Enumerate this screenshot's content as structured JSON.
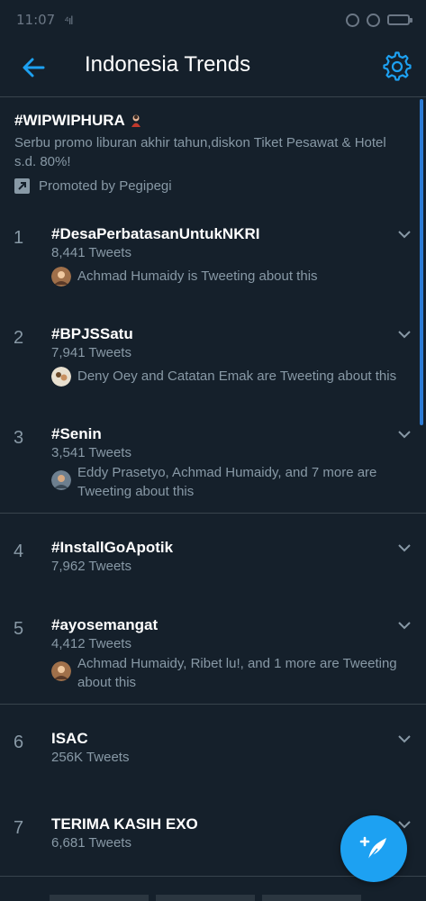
{
  "statusbar": {
    "time": "11:07",
    "signal": "⁴ıl"
  },
  "header": {
    "title": "Indonesia Trends"
  },
  "promo": {
    "title": "#WIPWIPHURA",
    "description": "Serbu promo liburan akhir tahun,diskon Tiket Pesawat & Hotel s.d. 80%!",
    "promoted_by": "Promoted by Pegipegi"
  },
  "trends": [
    {
      "rank": "1",
      "name": "#DesaPerbatasanUntukNKRI",
      "count": "8,441 Tweets",
      "context": "Achmad Humaidy is Tweeting about this"
    },
    {
      "rank": "2",
      "name": "#BPJSSatu",
      "count": "7,941 Tweets",
      "context": "Deny Oey and Catatan Emak are Tweeting about this"
    },
    {
      "rank": "3",
      "name": "#Senin",
      "count": "3,541 Tweets",
      "context": "Eddy Prasetyo, Achmad Humaidy, and 7 more are Tweeting about this"
    },
    {
      "rank": "4",
      "name": "#InstallGoApotik",
      "count": "7,962 Tweets",
      "context": ""
    },
    {
      "rank": "5",
      "name": "#ayosemangat",
      "count": "4,412 Tweets",
      "context": "Achmad Humaidy, Ribet lu!, and 1 more are Tweeting about this"
    },
    {
      "rank": "6",
      "name": "ISAC",
      "count": "256K Tweets",
      "context": ""
    },
    {
      "rank": "7",
      "name": "TERIMA KASIH EXO",
      "count": "6,681 Tweets",
      "context": ""
    }
  ],
  "icons": {
    "back": "arrow-left-icon",
    "settings": "gear-icon",
    "compose": "compose-tweet-icon"
  },
  "colors": {
    "background": "#15202b",
    "accent": "#1da1f2",
    "secondary_text": "#8899a6",
    "divider": "#38444d"
  }
}
